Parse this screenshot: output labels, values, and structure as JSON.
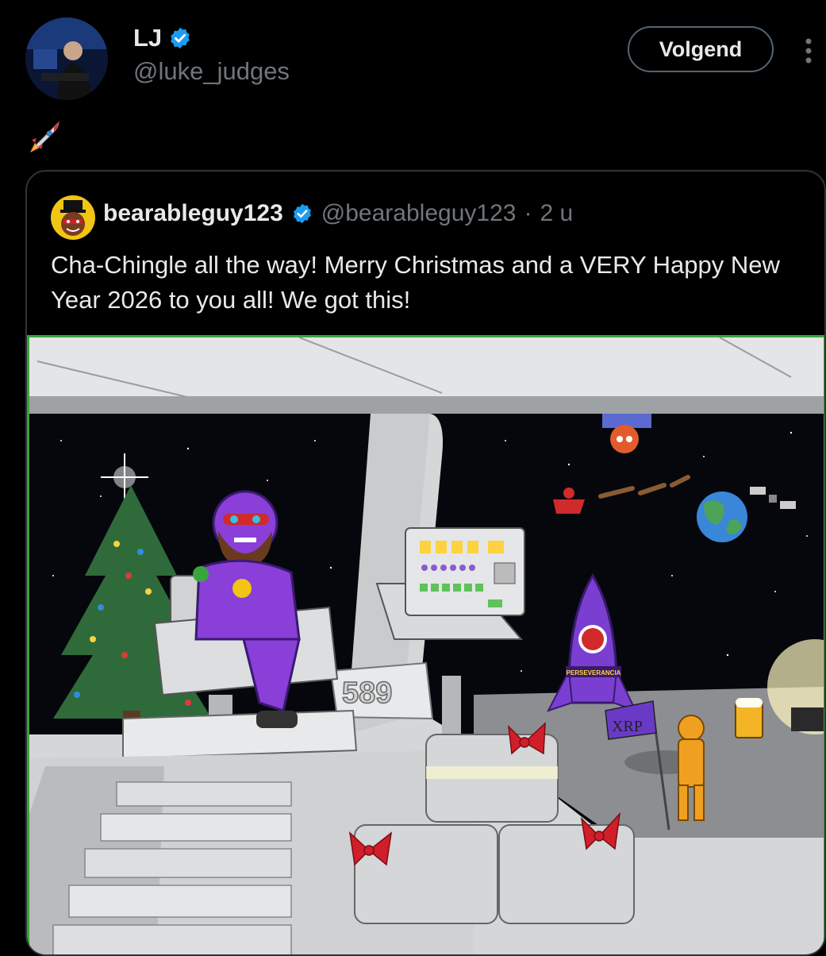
{
  "author": {
    "name": "LJ",
    "handle": "@luke_judges",
    "verified": true,
    "avatar_icon": "profile-photo"
  },
  "follow_button": {
    "label": "Volgend"
  },
  "menu_icon": "more-vertical-icon",
  "post": {
    "emoji": "rocket-emoji"
  },
  "quoted": {
    "author_name": "bearableguy123",
    "handle": "@bearableguy123",
    "separator": "·",
    "time": "2 u",
    "text": "Cha-Chingle all the way! Merry Christmas and a VERY Happy New Year 2026 to you all! We got this!",
    "image": {
      "number_sign": "589",
      "rocket_label": "PERSEVERANCIA",
      "flag_label": "XRP"
    }
  },
  "colors": {
    "background": "#000000",
    "verified_blue": "#1d9bf0",
    "muted_text": "#71767b",
    "border": "#2f3336",
    "media_border": "#3aa53a"
  }
}
